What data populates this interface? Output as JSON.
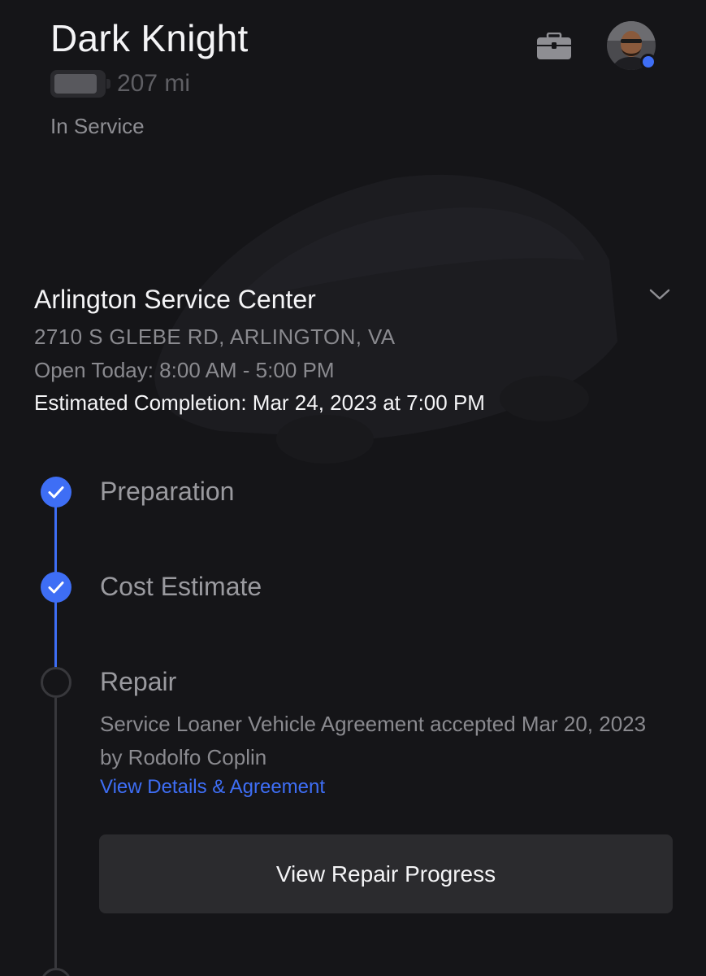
{
  "vehicle": {
    "name": "Dark Knight",
    "range": "207 mi",
    "status": "In Service"
  },
  "header": {
    "toolbox_icon": "toolbox-icon",
    "avatar_icon": "user-avatar",
    "notification_color": "#3e6ef5"
  },
  "service_center": {
    "name": "Arlington Service Center",
    "address": "2710 S GLEBE RD, ARLINGTON, VA",
    "hours": "Open Today: 8:00 AM - 5:00 PM",
    "estimated_completion": "Estimated Completion: Mar 24, 2023 at 7:00 PM",
    "expand_icon": "chevron-down-icon"
  },
  "timeline": {
    "steps": [
      {
        "label": "Preparation",
        "status": "complete"
      },
      {
        "label": "Cost Estimate",
        "status": "complete"
      },
      {
        "label": "Repair",
        "status": "pending"
      }
    ],
    "repair_note": "Service Loaner Vehicle Agreement accepted Mar 20, 2023 by Rodolfo Coplin",
    "repair_link": "View Details & Agreement",
    "progress_button": "View Repair Progress"
  },
  "colors": {
    "background": "#151518",
    "accent": "#3e6ef5",
    "button": "#2b2b2e"
  }
}
